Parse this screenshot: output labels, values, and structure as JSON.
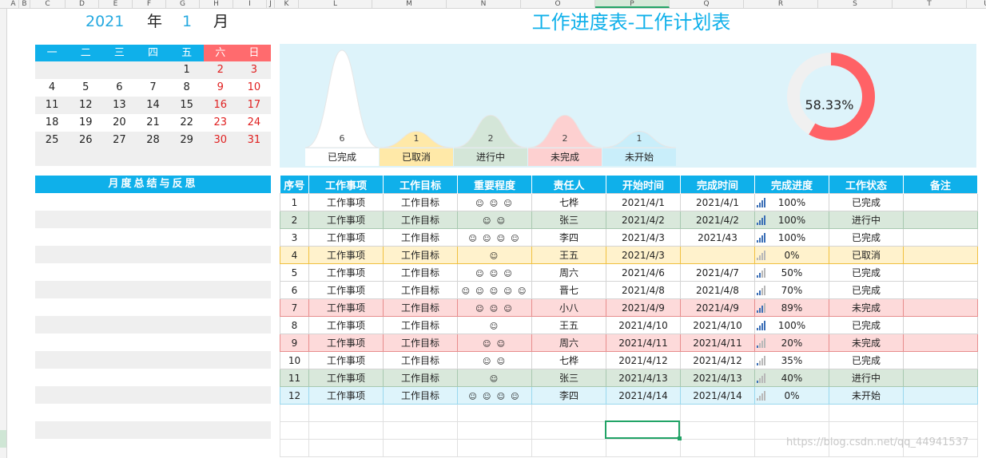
{
  "columns": [
    "A",
    "B",
    "C",
    "D",
    "E",
    "F",
    "G",
    "H",
    "I",
    "J",
    "K",
    "L",
    "M",
    "N",
    "O",
    "P",
    "Q",
    "R",
    "S",
    "T",
    "U"
  ],
  "header": {
    "year": "2021",
    "year_char": "年",
    "month": "1",
    "month_char": "月"
  },
  "calendar": {
    "weekdays": [
      "一",
      "二",
      "三",
      "四",
      "五",
      "六",
      "日"
    ],
    "weeks": [
      [
        "",
        "",
        "",
        "",
        "1",
        "2",
        "3"
      ],
      [
        "4",
        "5",
        "6",
        "7",
        "8",
        "9",
        "10"
      ],
      [
        "11",
        "12",
        "13",
        "14",
        "15",
        "16",
        "17"
      ],
      [
        "18",
        "19",
        "20",
        "21",
        "22",
        "23",
        "24"
      ],
      [
        "25",
        "26",
        "27",
        "28",
        "29",
        "30",
        "31"
      ]
    ]
  },
  "summary": {
    "title": "月度总结与反思"
  },
  "title": "工作进度表-工作计划表",
  "chart_data": {
    "type": "area",
    "categories": [
      "已完成",
      "已取消",
      "进行中",
      "未完成",
      "未开始"
    ],
    "values": [
      6,
      1,
      2,
      2,
      1
    ],
    "colors": [
      "#ffffff",
      "#ffe9a8",
      "#d4e6d8",
      "#fdd0d0",
      "#c9eefa"
    ],
    "donut": {
      "value": 58.33,
      "label": "58.33%",
      "color": "#ff6266",
      "track": "#f0f0f0"
    }
  },
  "table": {
    "headers": [
      "序号",
      "工作事项",
      "工作目标",
      "重要程度",
      "责任人",
      "开始时间",
      "完成时间",
      "完成进度",
      "工作状态",
      "备注"
    ],
    "rows": [
      {
        "no": "1",
        "task": "工作事项",
        "goal": "工作目标",
        "stars": "☺ ☺ ☺",
        "owner": "七桦",
        "start": "2021/4/1",
        "end": "2021/4/1",
        "progress": "100%",
        "pv": 1.0,
        "status": "已完成",
        "note": "",
        "cls": "s-done"
      },
      {
        "no": "2",
        "task": "工作事项",
        "goal": "工作目标",
        "stars": "☺ ☺",
        "owner": "张三",
        "start": "2021/4/2",
        "end": "2021/4/2",
        "progress": "100%",
        "pv": 1.0,
        "status": "进行中",
        "note": "",
        "cls": "s-prog"
      },
      {
        "no": "3",
        "task": "工作事项",
        "goal": "工作目标",
        "stars": "☺ ☺ ☺ ☺",
        "owner": "李四",
        "start": "2021/4/3",
        "end": "2021/43",
        "progress": "100%",
        "pv": 1.0,
        "status": "已完成",
        "note": "",
        "cls": "s-done"
      },
      {
        "no": "4",
        "task": "工作事项",
        "goal": "工作目标",
        "stars": "☺",
        "owner": "王五",
        "start": "2021/4/3",
        "end": "",
        "progress": "0%",
        "pv": 0.0,
        "status": "已取消",
        "note": "",
        "cls": "s-cancel"
      },
      {
        "no": "5",
        "task": "工作事项",
        "goal": "工作目标",
        "stars": "☺ ☺ ☺",
        "owner": "周六",
        "start": "2021/4/6",
        "end": "2021/4/7",
        "progress": "50%",
        "pv": 0.5,
        "status": "已完成",
        "note": "",
        "cls": "s-done"
      },
      {
        "no": "6",
        "task": "工作事项",
        "goal": "工作目标",
        "stars": "☺ ☺ ☺ ☺ ☺",
        "owner": "晋七",
        "start": "2021/4/8",
        "end": "2021/4/8",
        "progress": "70%",
        "pv": 0.7,
        "status": "已完成",
        "note": "",
        "cls": "s-done"
      },
      {
        "no": "7",
        "task": "工作事项",
        "goal": "工作目标",
        "stars": "☺ ☺ ☺",
        "owner": "小八",
        "start": "2021/4/9",
        "end": "2021/4/9",
        "progress": "89%",
        "pv": 0.89,
        "status": "未完成",
        "note": "",
        "cls": "s-unfin"
      },
      {
        "no": "8",
        "task": "工作事项",
        "goal": "工作目标",
        "stars": "☺",
        "owner": "王五",
        "start": "2021/4/10",
        "end": "2021/4/10",
        "progress": "100%",
        "pv": 1.0,
        "status": "已完成",
        "note": "",
        "cls": "s-done"
      },
      {
        "no": "9",
        "task": "工作事项",
        "goal": "工作目标",
        "stars": "☺ ☺",
        "owner": "周六",
        "start": "2021/4/11",
        "end": "2021/4/11",
        "progress": "20%",
        "pv": 0.2,
        "status": "未完成",
        "note": "",
        "cls": "s-unfin"
      },
      {
        "no": "10",
        "task": "工作事项",
        "goal": "工作目标",
        "stars": "☺ ☺",
        "owner": "七桦",
        "start": "2021/4/12",
        "end": "2021/4/12",
        "progress": "35%",
        "pv": 0.35,
        "status": "已完成",
        "note": "",
        "cls": "s-done"
      },
      {
        "no": "11",
        "task": "工作事项",
        "goal": "工作目标",
        "stars": "☺",
        "owner": "张三",
        "start": "2021/4/13",
        "end": "2021/4/13",
        "progress": "40%",
        "pv": 0.4,
        "status": "进行中",
        "note": "",
        "cls": "s-prog"
      },
      {
        "no": "12",
        "task": "工作事项",
        "goal": "工作目标",
        "stars": "☺ ☺ ☺ ☺",
        "owner": "李四",
        "start": "2021/4/14",
        "end": "2021/4/14",
        "progress": "0%",
        "pv": 0.0,
        "status": "未开始",
        "note": "",
        "cls": "s-unstart"
      }
    ]
  },
  "watermark": "https://blog.csdn.net/qq_44941537"
}
